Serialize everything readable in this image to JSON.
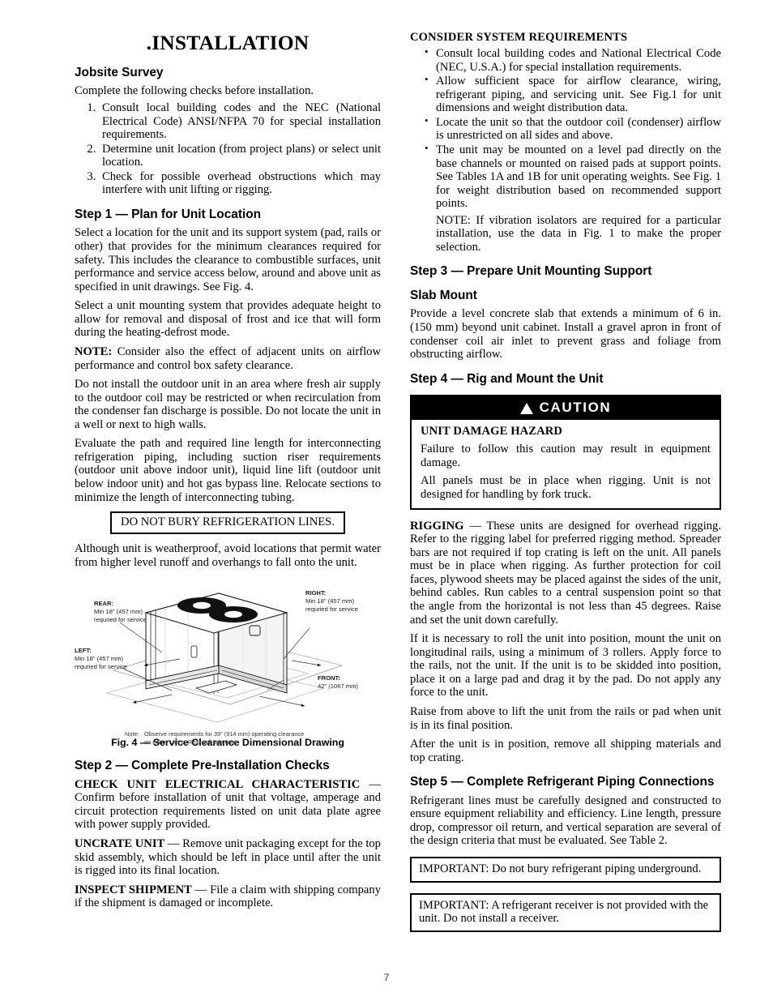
{
  "document": {
    "title": "INSTALLATION",
    "page_number": "7"
  },
  "left_column": {
    "jobsite_survey": {
      "heading": "Jobsite Survey",
      "intro": "Complete the following checks before installation.",
      "items": [
        "Consult local building codes and the NEC (National Electrical Code) ANSI/NFPA 70 for special installation requirements.",
        "Determine unit location (from project plans) or select unit location.",
        "Check for possible overhead obstructions which may interfere with unit lifting or rigging."
      ]
    },
    "step1": {
      "heading": "Step 1 — Plan for Unit Location",
      "p1": "Select a location for the unit and its support system (pad, rails or other) that provides for the minimum clearances required for safety. This includes the clearance to combustible surfaces, unit performance and service access below, around and above unit as specified in unit drawings. See Fig. 4.",
      "p2": "Select a unit mounting system that provides adequate height to allow for removal and disposal of frost and ice that will form during the heating-defrost mode.",
      "note_label": "NOTE:",
      "note_text": " Consider also the effect of adjacent units on airflow performance and control box safety clearance.",
      "p3": "Do not install the outdoor unit in an area where fresh air supply to the outdoor coil may be restricted or when recirculation from the condenser fan discharge is possible. Do not locate the unit in a well or next to high walls.",
      "p4": "Evaluate the path and required line length for interconnecting refrigeration piping, including suction riser requirements (outdoor unit above indoor unit), liquid line lift (outdoor unit below indoor unit) and hot gas bypass line. Relocate sections to minimize the length of interconnecting tubing.",
      "boxed_notice": "DO NOT BURY REFRIGERATION LINES.",
      "p5": "Although unit is weatherproof, avoid locations that permit water from higher level runoff and overhangs to fall onto the unit."
    },
    "figure": {
      "labels": {
        "rear_title": "REAR:",
        "rear_line1": "Min 18\" (457 mm)",
        "rear_line2": "requried for service",
        "right_title": "RIGHT:",
        "right_line1": "Min 18\" (457 mm)",
        "right_line2": "requried for service",
        "left_title": "LEFT:",
        "left_line1": "Min 18\" (457 mm)",
        "left_line2": "requried for service",
        "front_title": "FRONT:",
        "front_line1": "42\" (1067 mm)"
      },
      "note_label": "Note:",
      "note_line1": "Observe requirements for 39\" (914 mm) operating clearance",
      "note_line2": "on either Left or Rear coil opening.",
      "caption": "Fig. 4 — Service Clearance Dimensional Drawing"
    },
    "step2": {
      "heading": "Step 2 — Complete Pre-Installation Checks",
      "check_label": "CHECK UNIT ELECTRICAL CHARACTERISTIC",
      "check_text": " — Confirm before installation of unit that voltage, amperage and circuit protection requirements listed on unit data plate agree with power supply provided.",
      "uncrate_label": "UNCRATE UNIT",
      "uncrate_text": " — Remove unit packaging except for the top skid assembly, which should be left in place until after the unit is rigged into its final location.",
      "inspect_label": "INSPECT SHIPMENT",
      "inspect_text": " — File a claim with shipping company if the shipment is damaged or incomplete."
    }
  },
  "right_column": {
    "consider": {
      "heading": "CONSIDER SYSTEM REQUIREMENTS",
      "bullets": [
        "Consult local building codes and National Electrical Code (NEC, U.S.A.) for special installation requirements.",
        "Allow sufficient space for airflow clearance, wiring, refrigerant piping, and servicing unit. See Fig.1 for unit dimensions and weight distribution data.",
        "Locate the unit so that the outdoor coil (condenser) airflow is unrestricted on all sides and above.",
        "The unit may be mounted on a level pad directly on the base channels or mounted on raised pads at support points. See Tables 1A and 1B for unit operating weights. See Fig. 1 for weight distribution based on recommended support points."
      ],
      "note": "NOTE: If vibration isolators are required for a particular installation, use the data in Fig. 1 to make the proper selection."
    },
    "step3": {
      "heading": "Step 3 — Prepare Unit Mounting Support",
      "subheading": "Slab Mount",
      "text": "Provide a level concrete slab that extends a minimum of 6 in. (150 mm) beyond unit cabinet. Install a gravel apron in front of condenser coil air inlet to prevent grass and foliage from obstructing airflow."
    },
    "step4": {
      "heading": "Step 4 — Rig and Mount the Unit",
      "caution": {
        "bar_label": "CAUTION",
        "icon": "warning-triangle-icon",
        "hazard_title": "UNIT DAMAGE HAZARD",
        "p1": "Failure to follow this caution may result in equipment damage.",
        "p2": "All panels must be in place when rigging. Unit is not designed for handling by fork truck."
      },
      "rigging_label": "RIGGING",
      "rigging_text": " — These units are designed for overhead rigging. Refer to the rigging label for preferred rigging method. Spreader bars are not required if top crating is left on the unit. All panels must be in place when rigging. As further protection for coil faces, plywood sheets may be placed against the sides of the unit, behind cables. Run cables to a central suspension point so that the angle from the horizontal is not less than 45 degrees. Raise and set the unit down carefully.",
      "p2": "If it is necessary to roll the unit into position, mount the unit on longitudinal rails, using a minimum of 3 rollers. Apply force to the rails, not the unit. If the unit is to be skidded into position, place it on a large pad and drag it by the pad. Do not apply any force to the unit.",
      "p3": "Raise from above to lift the unit from the rails or pad when unit is in its final position.",
      "p4": "After the unit is in position, remove all shipping materials and top crating."
    },
    "step5": {
      "heading": "Step 5 — Complete Refrigerant Piping Connections",
      "text": "Refrigerant lines must be carefully designed and constructed to ensure equipment reliability and efficiency. Line length, pressure drop, compressor oil return, and vertical separation are several of the design criteria that must be evaluated. See Table 2.",
      "important1": "IMPORTANT: Do not bury refrigerant piping underground.",
      "important2": "IMPORTANT: A refrigerant receiver is not provided with the unit. Do not install a receiver."
    }
  }
}
